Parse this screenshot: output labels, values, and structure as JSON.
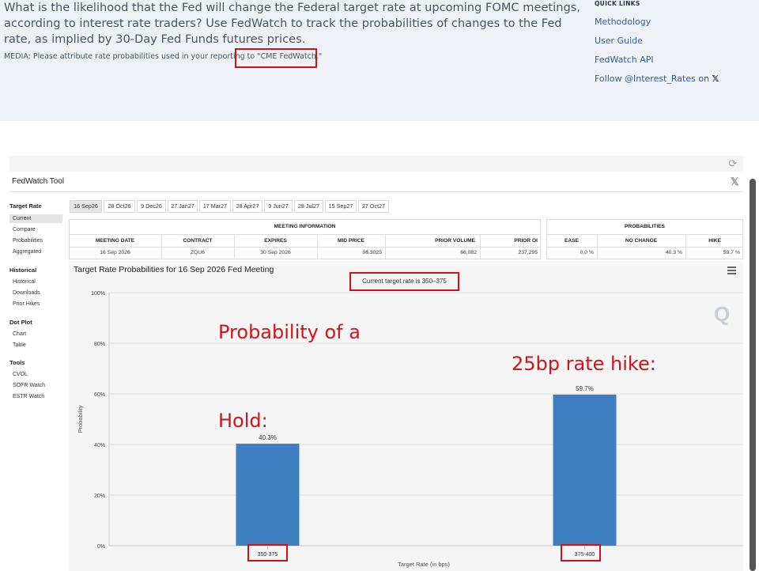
{
  "header": {
    "intro": "What is the likelihood that the Fed will change the Federal target rate at upcoming FOMC meetings, according to interest rate traders? Use FedWatch to track the probabilities of changes to the Fed rate, as implied by 30-Day Fed Funds futures prices.",
    "media_prefix": "MEDIA: Please attribute rate probabilities used in your reporting to ",
    "media_attrib": "\"CME FedWatch.\"",
    "quick_links_title": "QUICK LINKS",
    "quick_links": [
      "Methodology",
      "User Guide",
      "FedWatch API",
      "Follow @Interest_Rates on"
    ],
    "x_logo": "𝕏"
  },
  "tool": {
    "title": "FedWatch Tool",
    "close_glyph": "𝕏",
    "refresh_glyph": "⟳"
  },
  "sidebar": {
    "target_rate": {
      "heading": "Target Rate",
      "items": [
        "Current",
        "Compare",
        "Probabilities",
        "Aggregated"
      ]
    },
    "historical": {
      "heading": "Historical",
      "items": [
        "Historical",
        "Downloads",
        "Prior Hikes"
      ]
    },
    "dot_plot": {
      "heading": "Dot Plot",
      "items": [
        "Chart",
        "Table"
      ]
    },
    "tools": {
      "heading": "Tools",
      "items": [
        "CVOL",
        "SOFR Watch",
        "ESTR Watch"
      ]
    },
    "active_item": "Current"
  },
  "date_tabs": [
    "16 Sep26",
    "28 Oct26",
    "9 Dec26",
    "27 Jan27",
    "17 Mar27",
    "28 Apr27",
    "9 Jun27",
    "28 Jul27",
    "15 Sep27",
    "27 Oct27"
  ],
  "active_tab": "16 Sep26",
  "meeting_info": {
    "title": "MEETING INFORMATION",
    "columns": [
      "MEETING DATE",
      "CONTRACT",
      "EXPIRES",
      "MID PRICE",
      "PRIOR VOLUME",
      "PRIOR OI"
    ],
    "row": [
      "16 Sep 2026",
      "ZQU6",
      "30 Sep 2026",
      "96.3025",
      "66,082",
      "237,295"
    ]
  },
  "probabilities": {
    "title": "PROBABILITIES",
    "columns": [
      "EASE",
      "NO CHANGE",
      "HIKE"
    ],
    "row": [
      "0.0 %",
      "40.3 %",
      "59.7 %"
    ]
  },
  "chart": {
    "title": "Target Rate Probabilities for 16 Sep 2026 Fed Meeting",
    "current_rate": "Current target rate is 350–375",
    "annotation_1": "Probability of a",
    "annotation_2": "Hold:",
    "annotation_3": "25bp rate hike:",
    "colors": {
      "bar": "#3c7ebf",
      "grid": "#dedede",
      "annotation": "#d0121b"
    }
  },
  "chart_data": {
    "type": "bar",
    "categories": [
      "350-375",
      "375-400"
    ],
    "values": [
      40.3,
      59.7
    ],
    "data_labels": [
      "40.3%",
      "59.7%"
    ],
    "title": "Target Rate Probabilities for 16 Sep 2026 Fed Meeting",
    "xlabel": "Target Rate (in bps)",
    "ylabel": "Probability",
    "ylim": [
      0,
      100
    ],
    "yticks": [
      "0%",
      "20%",
      "40%",
      "60%",
      "80%",
      "100%"
    ],
    "ytick_values": [
      0,
      20,
      40,
      60,
      80,
      100
    ],
    "grid": true
  }
}
